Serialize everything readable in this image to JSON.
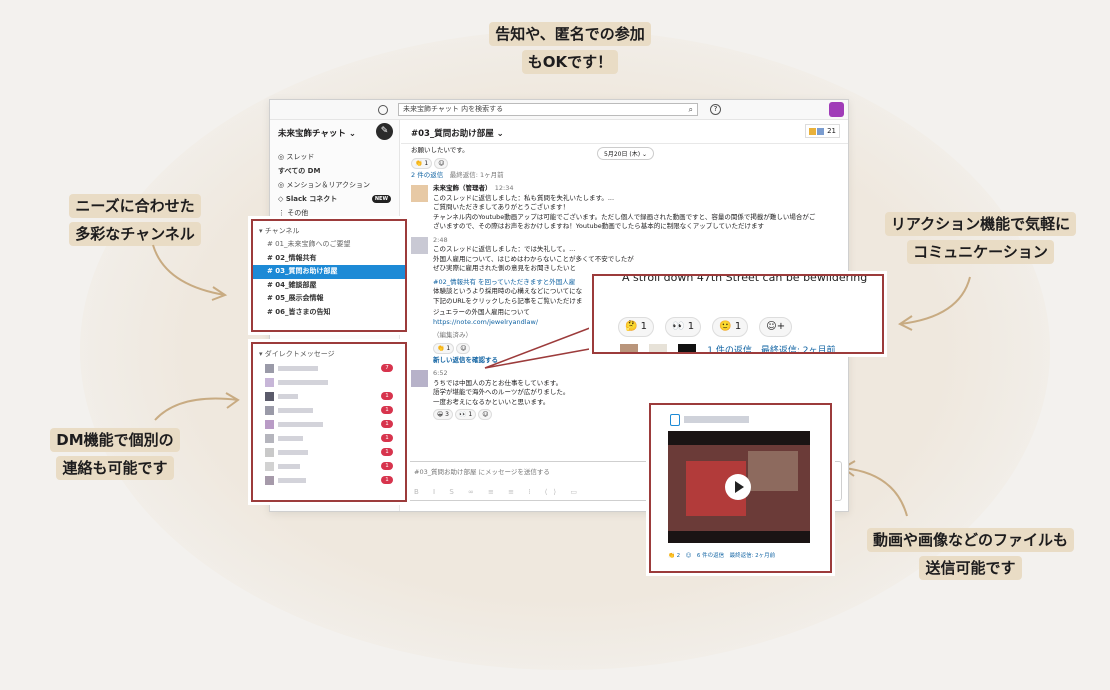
{
  "callouts": {
    "top": [
      "告知や、匿名での参加",
      "もOKです！"
    ],
    "left_top": [
      "ニーズに合わせた",
      "多彩なチャンネル"
    ],
    "left_bottom": [
      "DM機能で個別の",
      "連絡も可能です"
    ],
    "right_top": [
      "リアクション機能で気軽に",
      "コミュニケーション"
    ],
    "right_bottom": [
      "動画や画像などのファイルも",
      "送信可能です"
    ]
  },
  "topbar": {
    "search_placeholder": "未来宝飾チャット 内を検索する",
    "help": "?"
  },
  "workspace": {
    "name": "未来宝飾チャット ⌄",
    "edit_icon": "✎"
  },
  "nav": {
    "items": [
      "◎ スレッド",
      "すべての DM",
      "◎ メンション＆リアクション",
      "◇ Slack コネクト",
      "⋮ その他"
    ],
    "new_badge": "NEW"
  },
  "channels": {
    "header": "▾ チャンネル",
    "items": [
      {
        "label": "# 01_未来宝飾へのご要望",
        "state": "dim"
      },
      {
        "label": "# 02_情報共有",
        "state": ""
      },
      {
        "label": "# 03_質問お助け部屋",
        "state": "active"
      },
      {
        "label": "# 04_雑談部屋",
        "state": ""
      },
      {
        "label": "# 05_展示会情報",
        "state": ""
      },
      {
        "label": "# 06_皆さまの告知",
        "state": ""
      }
    ]
  },
  "dms": {
    "header": "▾ ダイレクトメッセージ",
    "badges": [
      "7",
      "",
      "1",
      "1",
      "1",
      "1",
      "1",
      "1",
      "1"
    ]
  },
  "channel_header": {
    "title": "#03_質問お助け部屋 ⌄",
    "members": "21"
  },
  "messages": {
    "date_pill": "5月20日 (木) ⌄",
    "top_line": "お願いしたいです。",
    "thread_top": "2 件の返信",
    "thread_top_meta": "最終返信: 1ヶ月前",
    "admin_name": "未来宝飾（管理者）",
    "admin_time": "12:34",
    "admin_lines": [
      "このスレッドに返信しました：私も質問を失礼いたします。...",
      "ご質問いただきましてありがとうございます！",
      "チャンネル内のYoutube動画アップは可能でございます。ただし個人で録画された動画ですと、容量の関係で掲載が難しい場合がご",
      "ざいますので、その際はお声をおかけしますね！Youtube動画でしたら基本的に制限なくアップしていただけます"
    ],
    "msg2_time": "2:48",
    "msg2_lines": [
      "このスレッドに返信しました：では失礼して。...",
      "外国人雇用について、はじめはわからないことが多くて不安でしたが",
      "ぜひ実際に雇用された側の意見をお聞きしたいと"
    ],
    "msg2b_lines": [
      "#02_情報共有 を回っていただきますと外国人雇",
      "体験談というより採用時の心構えなどについてにな",
      "下記のURLをクリックしたら記事をご覧いただけま",
      "ジュエラーの外国人雇用について",
      "https://note.com/jewelryandlaw/"
    ],
    "edited": "（編集済み）",
    "new_replies": "新しい返信を確認する",
    "msg3_time": "6:52",
    "msg3_lines": [
      "うちでは中国人の方とお仕事をしています。",
      "語学が堪能で海外へのルーツが広がりました。",
      "一度お考えになるかといいと思います。"
    ],
    "reacts_a": [
      "👏 1",
      "☺"
    ],
    "reacts_b": [
      "👏 1",
      "☺"
    ],
    "reacts_c": [
      "😀 3",
      "👀 1",
      "☺"
    ]
  },
  "compose": {
    "placeholder": "#03_質問お助け部屋 にメッセージを送信する",
    "tools": "B I S ∞ ≡ ≡ ⁞ ⟨⟩ ▭"
  },
  "popup": {
    "cut_text": "A stroll down 47th Street can be bewildering",
    "reactions": [
      "🤔 1",
      "👀 1",
      "🙂 1",
      "☺+"
    ],
    "bottom_text": "1 件の返信　最終返信: 2ヶ月前"
  },
  "video": {
    "footer": "👏 2　☺　6 件の返信　最終返信: 2ヶ月前"
  }
}
